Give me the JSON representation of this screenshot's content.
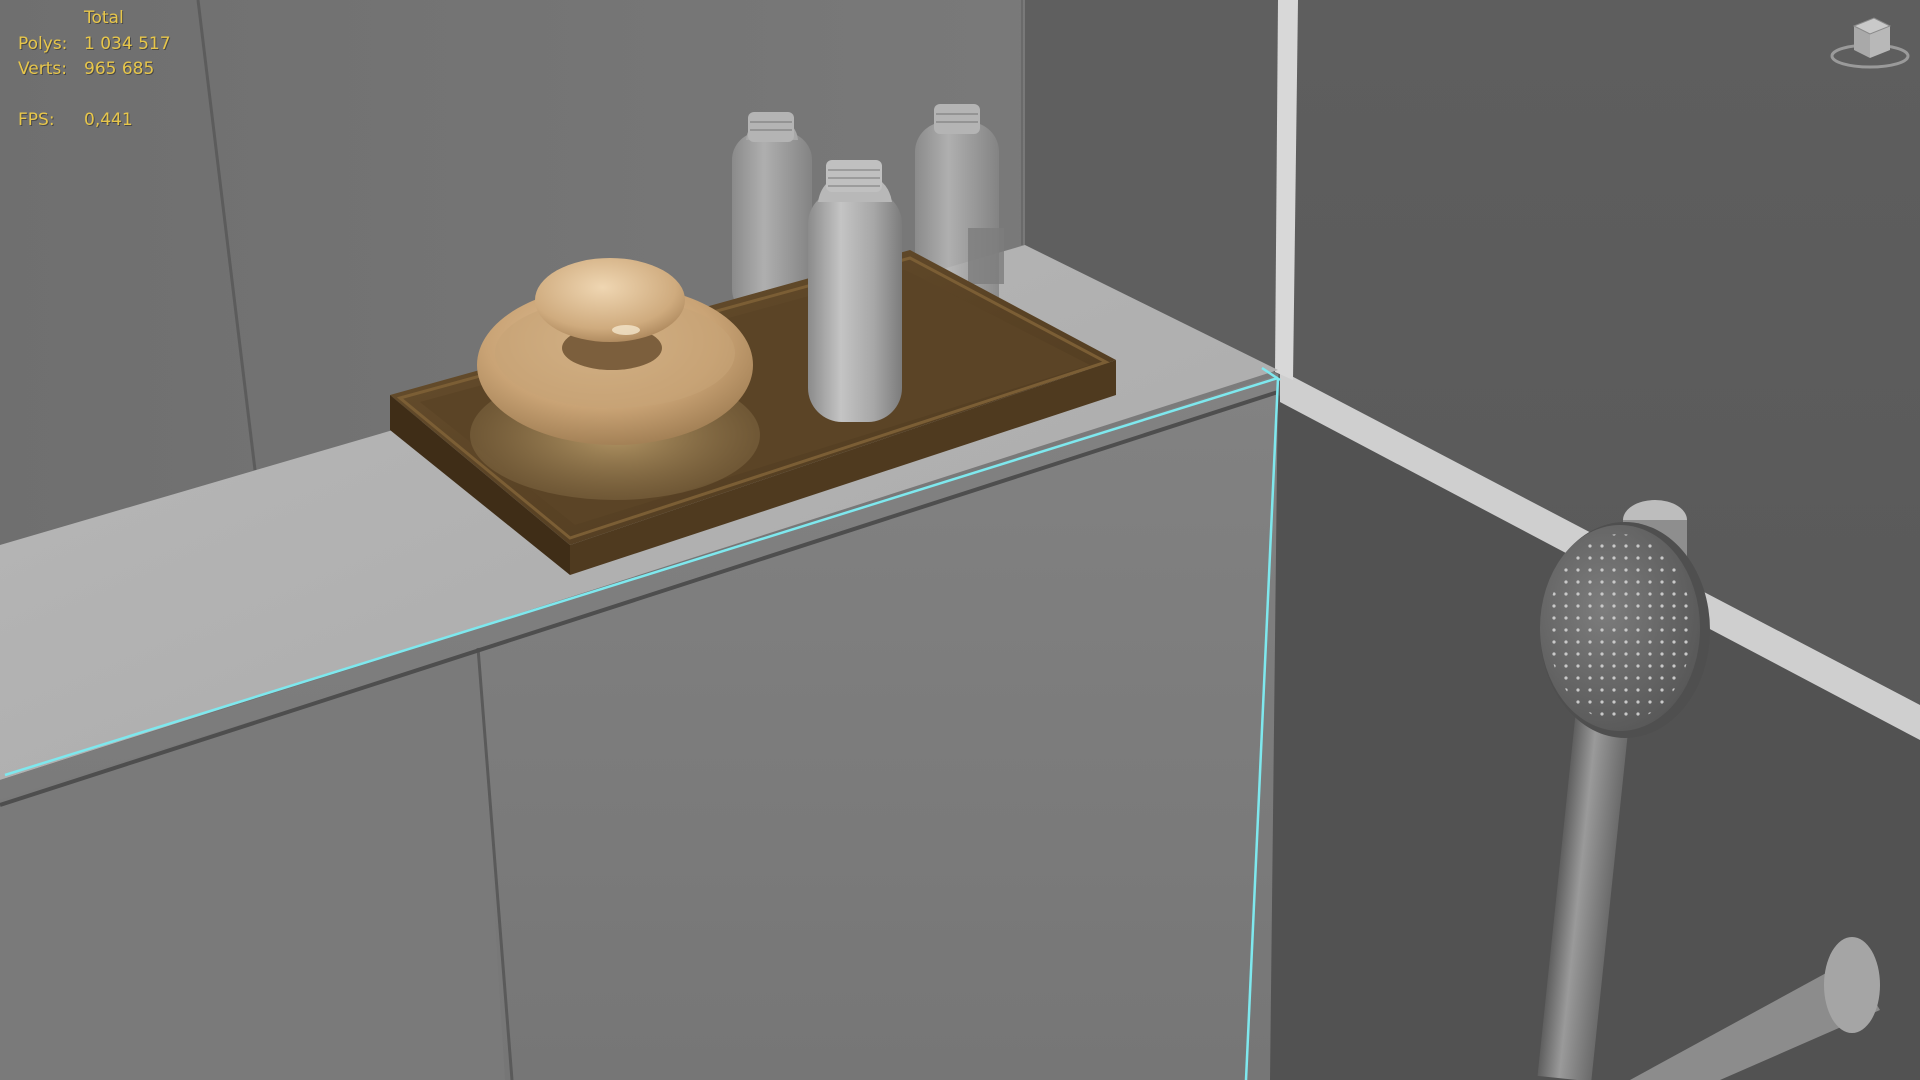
{
  "viewport": {
    "stats": {
      "header": "Total",
      "polys_label": "Polys:",
      "polys_value": "1 034 517",
      "verts_label": "Verts:",
      "verts_value": "965 685",
      "fps_label": "FPS:",
      "fps_value": "0,441"
    },
    "colors": {
      "stats_text": "#e7c64a",
      "selection_edge": "#7ee8ee",
      "wall_back": "#777777",
      "wall_right": "#5c5c5c",
      "ledge_top": "#b4b4b4",
      "tray_wood": "#5e4727",
      "bottle": "#a9a9a9",
      "loofah_wood": "#c9a57a"
    },
    "viewcube_icon": "viewcube-icon"
  }
}
